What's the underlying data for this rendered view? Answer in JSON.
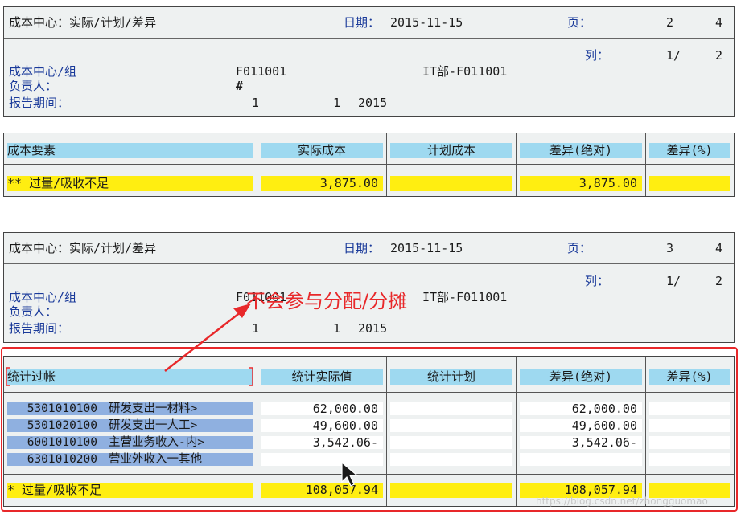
{
  "report1": {
    "title": "成本中心：实际/计划/差异",
    "date_label": "日期：",
    "date": "2015-11-15",
    "page_label": "页：",
    "page_current": "2",
    "page_total": "4",
    "col_label": "列：",
    "col_current": "1/",
    "col_total": "2",
    "cc_label": "成本中心/组",
    "cc_value": "F011001",
    "cc_name": "IT部-F011001",
    "owner_label": "负责人：",
    "owner_value": "#",
    "period_label": "报告期间：",
    "period_from": "1",
    "period_to": "1",
    "period_year": "2015"
  },
  "table1": {
    "headers": [
      "成本要素",
      "实际成本",
      "计划成本",
      "差异(绝对)",
      "差异(%)"
    ],
    "total_row": {
      "label": "** 过量/吸收不足",
      "actual": "3,875.00",
      "plan": "",
      "variance": "3,875.00",
      "pct": ""
    }
  },
  "report2": {
    "title": "成本中心：实际/计划/差异",
    "date_label": "日期：",
    "date": "2015-11-15",
    "page_label": "页：",
    "page_current": "3",
    "page_total": "4",
    "col_label": "列：",
    "col_current": "1/",
    "col_total": "2",
    "cc_label": "成本中心/组",
    "cc_value": "F011001",
    "cc_name": "IT部-F011001",
    "owner_label": "负责人：",
    "period_label": "报告期间：",
    "period_from": "1",
    "period_to": "1",
    "period_year": "2015"
  },
  "table2": {
    "headers": [
      "统计过帐",
      "统计实际值",
      "统计计划",
      "差异(绝对)",
      "差异(%)"
    ],
    "rows": [
      {
        "account": "5301010100",
        "name": "研发支出一材料>",
        "actual": "62,000.00",
        "plan": "",
        "variance": "62,000.00",
        "pct": ""
      },
      {
        "account": "5301020100",
        "name": "研发支出一人工>",
        "actual": "49,600.00",
        "plan": "",
        "variance": "49,600.00",
        "pct": ""
      },
      {
        "account": "6001010100",
        "name": "主营业务收入-内>",
        "actual": "3,542.06-",
        "plan": "",
        "variance": "3,542.06-",
        "pct": ""
      },
      {
        "account": "6301010200",
        "name": "营业外收入一其他",
        "actual": "",
        "plan": "",
        "variance": "",
        "pct": ""
      }
    ],
    "total_row": {
      "label": "* 过量/吸收不足",
      "actual": "108,057.94",
      "plan": "",
      "variance": "108,057.94",
      "pct": ""
    }
  },
  "annotation": {
    "text": "不会参与分配/分摊",
    "color": "#e8282a"
  },
  "watermark": "https://blog.csdn.net/zhongguomao"
}
